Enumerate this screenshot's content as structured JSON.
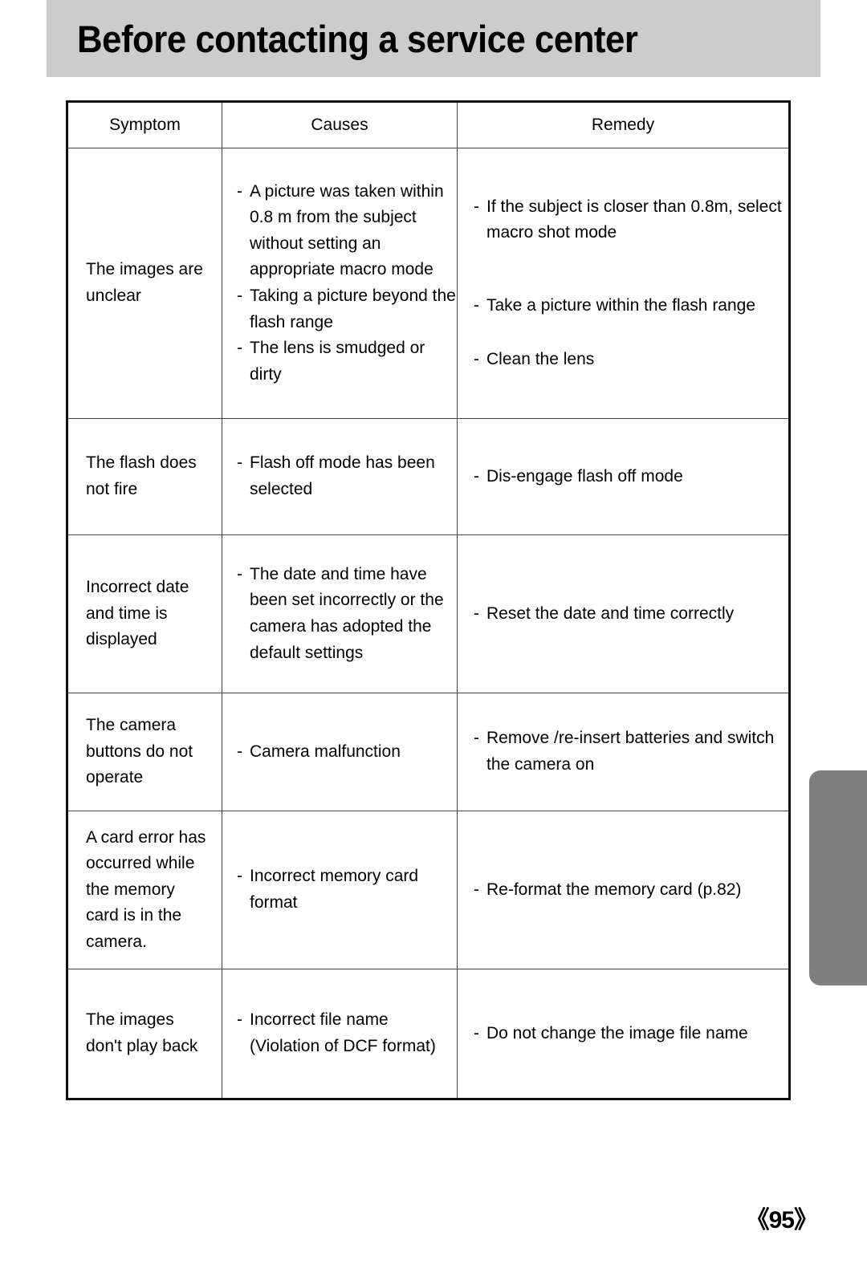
{
  "header": {
    "title": "Before contacting a service center"
  },
  "table": {
    "columns": [
      "Symptom",
      "Causes",
      "Remedy"
    ],
    "rows": [
      {
        "symptom": [
          "The images are",
          "unclear"
        ],
        "causes": [
          "A picture was taken within 0.8 m from the subject without setting an appropriate macro mode",
          "Taking a picture beyond the flash range",
          "The lens is smudged or dirty"
        ],
        "remedy": [
          "If the subject is closer than 0.8m, select macro shot mode",
          "Take a picture within the flash range",
          "Clean the lens"
        ]
      },
      {
        "symptom": [
          "The flash does",
          "not fire"
        ],
        "causes": [
          "Flash off mode has been selected"
        ],
        "remedy": [
          "Dis-engage flash off mode"
        ]
      },
      {
        "symptom": [
          "Incorrect date",
          "and time is",
          "displayed"
        ],
        "causes": [
          "The date and time have been set incorrectly or the camera has adopted the default settings"
        ],
        "remedy": [
          "Reset the date and time correctly"
        ]
      },
      {
        "symptom": [
          "The camera",
          "buttons do not",
          "operate"
        ],
        "causes": [
          "Camera malfunction"
        ],
        "remedy": [
          "Remove /re-insert batteries and switch the camera on"
        ]
      },
      {
        "symptom": [
          "A card error has",
          "occurred while",
          "the memory",
          "card is in the",
          "camera."
        ],
        "causes": [
          "Incorrect memory card format"
        ],
        "remedy": [
          "Re-format the memory card (p.82)"
        ]
      },
      {
        "symptom": [
          "The images",
          "don't play back"
        ],
        "causes": [
          "Incorrect file name (Violation of DCF format)"
        ],
        "remedy": [
          "Do not change the image file name"
        ]
      }
    ]
  },
  "footer": {
    "page_number": "《95》"
  },
  "colors": {
    "banner_gray": "#cccccc",
    "tab_gray": "#7f7f7f",
    "border": "#111111",
    "text": "#000000"
  }
}
